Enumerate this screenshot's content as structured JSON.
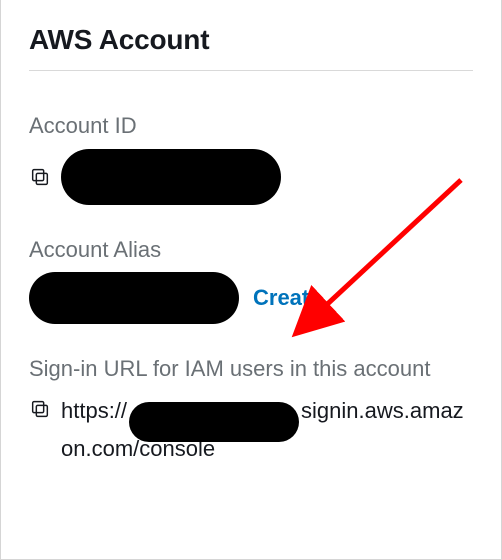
{
  "panel": {
    "title": "AWS Account"
  },
  "account_id": {
    "label": "Account ID",
    "value_redacted": true
  },
  "account_alias": {
    "label": "Account Alias",
    "value_redacted": true,
    "create_label": "Create"
  },
  "signin_url": {
    "label": "Sign-in URL for IAM users in this account",
    "prefix": "https://",
    "mid_redacted": true,
    "suffix": "signin.aws.amazon.com/console"
  },
  "icons": {
    "copy": "copy-icon"
  },
  "annotation": {
    "arrow_color": "#ff0000"
  }
}
